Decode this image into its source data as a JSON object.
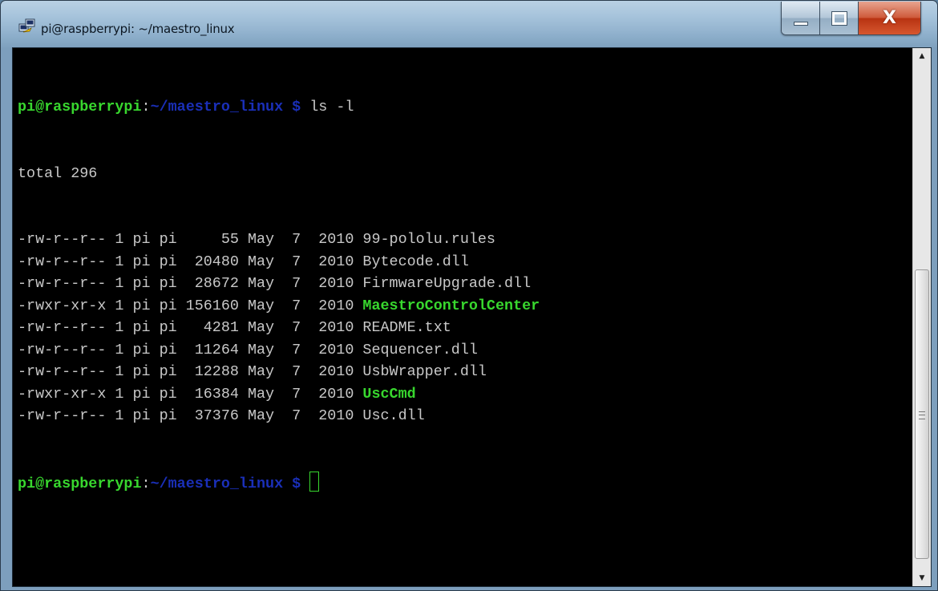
{
  "window": {
    "title": "pi@raspberrypi: ~/maestro_linux",
    "icon": "putty-icon",
    "buttons": {
      "minimize": "minimize-icon",
      "maximize": "maximize-icon",
      "close": "close-icon"
    },
    "close_glyph": "X"
  },
  "terminal": {
    "prompt_user": "pi@raspberrypi",
    "prompt_sep": ":",
    "prompt_path": "~/maestro_linux $",
    "command": "ls -l",
    "total": "total 296",
    "listing": [
      {
        "text": "-rw-r--r-- 1 pi pi     55 May  7  2010 ",
        "name": "99-pololu.rules",
        "exec": false
      },
      {
        "text": "-rw-r--r-- 1 pi pi  20480 May  7  2010 ",
        "name": "Bytecode.dll",
        "exec": false
      },
      {
        "text": "-rw-r--r-- 1 pi pi  28672 May  7  2010 ",
        "name": "FirmwareUpgrade.dll",
        "exec": false
      },
      {
        "text": "-rwxr-xr-x 1 pi pi 156160 May  7  2010 ",
        "name": "MaestroControlCenter",
        "exec": true
      },
      {
        "text": "-rw-r--r-- 1 pi pi   4281 May  7  2010 ",
        "name": "README.txt",
        "exec": false
      },
      {
        "text": "-rw-r--r-- 1 pi pi  11264 May  7  2010 ",
        "name": "Sequencer.dll",
        "exec": false
      },
      {
        "text": "-rw-r--r-- 1 pi pi  12288 May  7  2010 ",
        "name": "UsbWrapper.dll",
        "exec": false
      },
      {
        "text": "-rwxr-xr-x 1 pi pi  16384 May  7  2010 ",
        "name": "UscCmd",
        "exec": true
      },
      {
        "text": "-rw-r--r-- 1 pi pi  37376 May  7  2010 ",
        "name": "Usc.dll",
        "exec": false
      }
    ],
    "colors": {
      "user": "#38d72e",
      "path": "#1a2fb8",
      "text": "#c8c8c8",
      "exec": "#38d72e",
      "background": "#000000"
    }
  },
  "scrollbar": {
    "up_icon": "arrow-up-icon",
    "down_icon": "arrow-down-icon",
    "up_glyph": "▲",
    "down_glyph": "▼",
    "position_fraction": 0.41
  }
}
